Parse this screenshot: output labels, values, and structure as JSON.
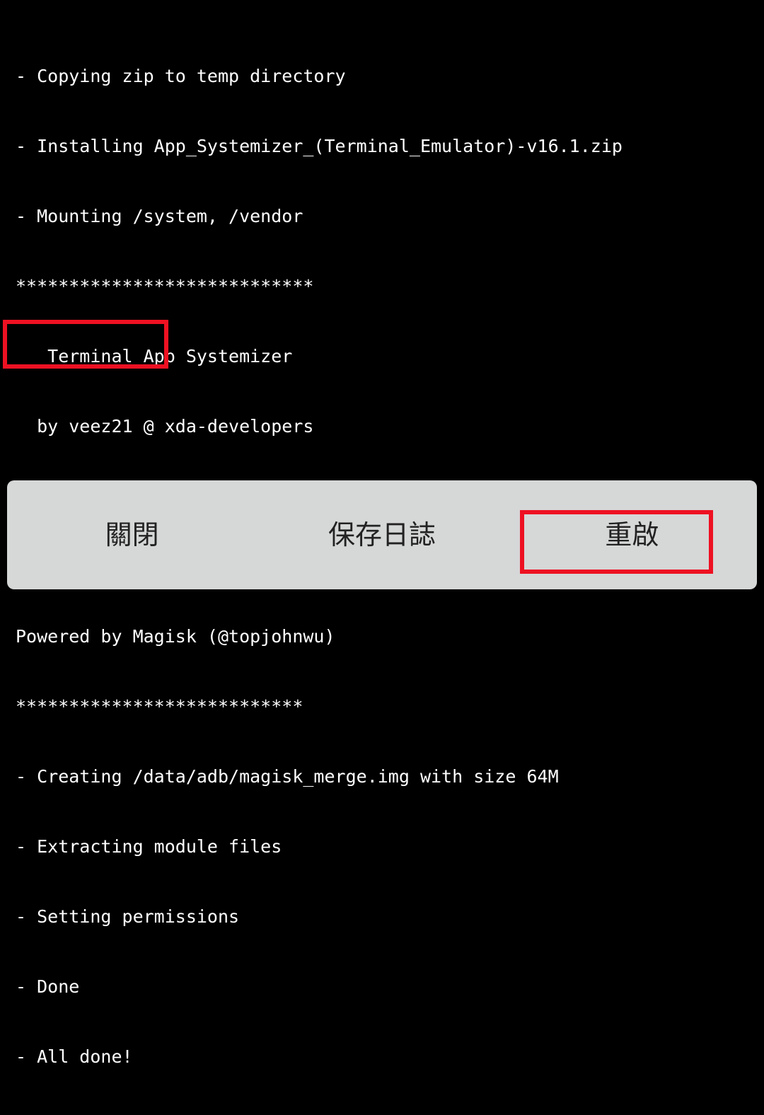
{
  "console": {
    "background_color": "#000000",
    "text_color": "#ffffff",
    "lines": [
      "- Copying zip to temp directory",
      "- Installing App_Systemizer_(Terminal_Emulator)-v16.1.zip",
      "- Mounting /system, /vendor",
      "****************************",
      "   Terminal App Systemizer",
      "  by veez21 @ xda-developers",
      "***************************",
      "***************************",
      "Powered by Magisk (@topjohnwu)",
      "***************************",
      "- Creating /data/adb/magisk_merge.img with size 64M",
      "- Extracting module files",
      "- Setting permissions",
      "- Done",
      "- All done!"
    ],
    "line_texts": {
      "l0": "- Copying zip to temp directory",
      "l1": "- Installing App_Systemizer_(Terminal_Emulator)-v16.1.zip",
      "l2": "- Mounting /system, /vendor",
      "l3": "****************************",
      "l4": "   Terminal App Systemizer",
      "l5": "  by veez21 @ xda-developers",
      "l6": "***************************",
      "l7": "***************************",
      "l8": "Powered by Magisk (@topjohnwu)",
      "l9": "***************************",
      "l10": "- Creating /data/adb/magisk_merge.img with size 64M",
      "l11": "- Extracting module files",
      "l12": "- Setting permissions",
      "l13": "- Done",
      "l14": "- All done!"
    }
  },
  "annotations": {
    "color": "#ee1122",
    "log_highlight": {
      "target_lines": "- Done / - All done!"
    },
    "reboot_highlight": {
      "target": "重啟"
    }
  },
  "button_bar": {
    "background_color": "#d6d7d7",
    "text_color": "#222222",
    "buttons": [
      {
        "id": "close",
        "label": "關閉",
        "highlighted": false
      },
      {
        "id": "savelog",
        "label": "保存日誌",
        "highlighted": false
      },
      {
        "id": "reboot",
        "label": "重啟",
        "highlighted": true
      }
    ]
  }
}
